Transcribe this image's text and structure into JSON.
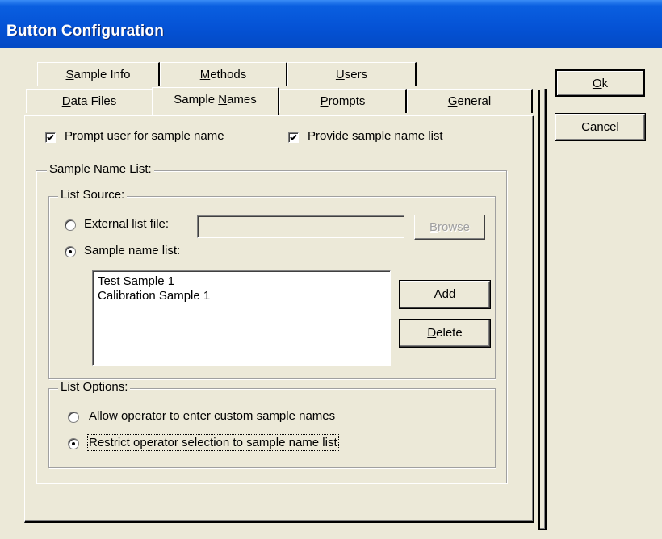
{
  "window": {
    "title": "Button Configuration"
  },
  "buttons": {
    "ok": {
      "key": "O",
      "rest": "k"
    },
    "cancel": {
      "key": "C",
      "rest": "ancel"
    }
  },
  "tabs": {
    "row_back": [
      {
        "key": "S",
        "rest": "ample Info"
      },
      {
        "key": "M",
        "rest": "ethods"
      },
      {
        "key": "U",
        "rest": "sers"
      }
    ],
    "row_front": [
      {
        "key": "D",
        "rest": "ata Files",
        "pre": ""
      },
      {
        "pre": "Sample ",
        "key": "N",
        "rest": "ames"
      },
      {
        "key": "P",
        "rest": "rompts",
        "pre": ""
      },
      {
        "key": "G",
        "rest": "eneral",
        "pre": ""
      }
    ]
  },
  "options": {
    "prompt_user": {
      "label": "Prompt user for sample name",
      "checked": true
    },
    "provide_list": {
      "label": "Provide sample name list",
      "checked": true
    }
  },
  "sample_name_list": {
    "legend": "Sample Name List:",
    "list_source": {
      "legend": "List Source:",
      "external_label": "External list file:",
      "external_value": "",
      "browse": {
        "key": "B",
        "rest": "rowse"
      },
      "sample_list_label": "Sample name list:",
      "selected": "sample_list",
      "items": [
        "Test Sample 1",
        "Calibration Sample 1"
      ],
      "add": {
        "key": "A",
        "rest": "dd"
      },
      "delete": {
        "key": "D",
        "rest": "elete"
      }
    },
    "list_options": {
      "legend": "List Options:",
      "allow_custom": "Allow operator to enter custom sample names",
      "restrict": "Restrict operator selection to sample name list",
      "selected": "restrict"
    }
  }
}
